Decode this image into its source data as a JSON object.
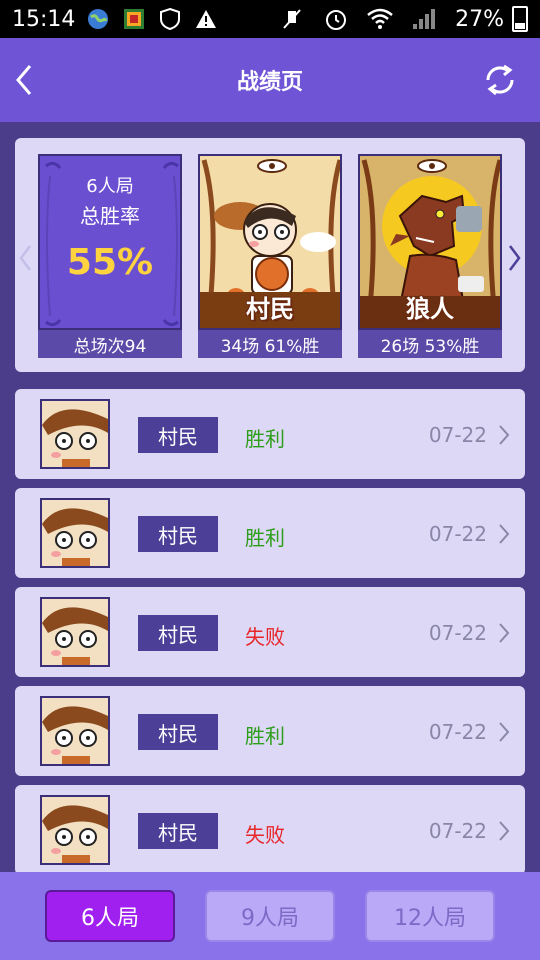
{
  "status_bar": {
    "time": "15:14",
    "battery": "27%"
  },
  "header": {
    "title": "战绩页"
  },
  "summary": {
    "overall": {
      "mode": "6人局",
      "label": "总胜率",
      "win_rate": "55%",
      "total_games": "总场次94"
    },
    "roles": [
      {
        "name": "村民",
        "stats": "34场 61%胜"
      },
      {
        "name": "狼人",
        "stats": "26场 53%胜"
      }
    ]
  },
  "records": [
    {
      "role": "村民",
      "result": "胜利",
      "outcome": "win",
      "date": "07-22"
    },
    {
      "role": "村民",
      "result": "胜利",
      "outcome": "win",
      "date": "07-22"
    },
    {
      "role": "村民",
      "result": "失败",
      "outcome": "lose",
      "date": "07-22"
    },
    {
      "role": "村民",
      "result": "胜利",
      "outcome": "win",
      "date": "07-22"
    },
    {
      "role": "村民",
      "result": "失败",
      "outcome": "lose",
      "date": "07-22"
    }
  ],
  "tabs": [
    {
      "label": "6人局",
      "active": true
    },
    {
      "label": "9人局",
      "active": false
    },
    {
      "label": "12人局",
      "active": false
    }
  ],
  "colors": {
    "header_bg": "#6f54d6",
    "win": "#2e9e1a",
    "lose": "#e8262a",
    "active_tab": "#a020f0",
    "win_rate": "#ffd23f"
  },
  "icons": {
    "back": "back-arrow-icon",
    "refresh": "refresh-icon",
    "carousel_prev": "chevron-left-icon",
    "carousel_next": "chevron-right-icon",
    "row_chevron": "chevron-right-icon"
  }
}
